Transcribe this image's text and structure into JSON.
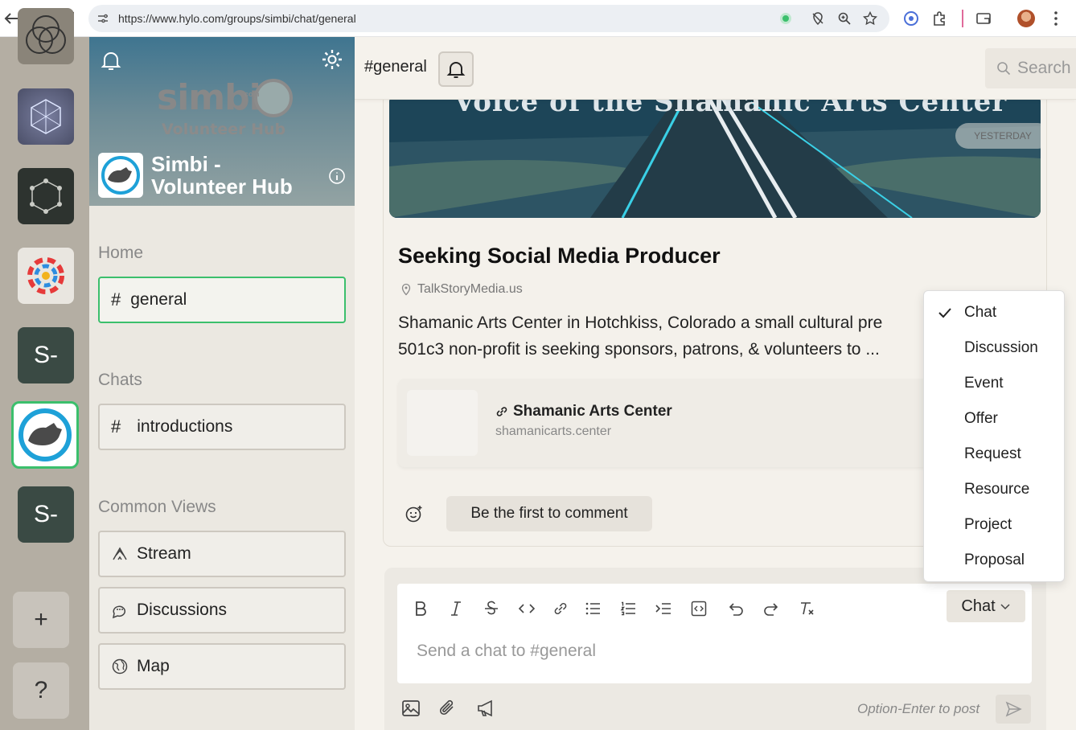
{
  "browser": {
    "url": "https://www.hylo.com/groups/simbi/chat/general"
  },
  "rail": {
    "tiles": [
      {
        "name": "group-1",
        "label": ""
      },
      {
        "name": "group-2",
        "label": ""
      },
      {
        "name": "group-3",
        "label": ""
      },
      {
        "name": "group-4",
        "label": ""
      },
      {
        "name": "group-5",
        "label": "S-"
      },
      {
        "name": "group-simbi",
        "label": ""
      },
      {
        "name": "group-7",
        "label": "S-"
      }
    ],
    "add_label": "+",
    "help_label": "?"
  },
  "sidebar": {
    "banner_logo": "simbi",
    "banner_logo_small": "com",
    "banner_subtitle": "Volunteer Hub",
    "group_name_line1": "Simbi -",
    "group_name_line2": "Volunteer Hub",
    "home_heading": "Home",
    "home_items": [
      {
        "label": "general"
      }
    ],
    "chats_heading": "Chats",
    "chat_items": [
      {
        "label": "introductions"
      }
    ],
    "views_heading": "Common Views",
    "view_items": [
      {
        "label": "Stream",
        "icon": "stream-icon"
      },
      {
        "label": "Discussions",
        "icon": "discussions-icon"
      },
      {
        "label": "Map",
        "icon": "globe-icon"
      }
    ]
  },
  "topbar": {
    "channel": "#general",
    "search_placeholder": "Search"
  },
  "post": {
    "image_caption": "Voice of the Shamanic Arts Center",
    "date_badge": "YESTERDAY",
    "title": "Seeking Social Media Producer",
    "location": "TalkStoryMedia.us",
    "body_line1": "Shamanic Arts Center in Hotchkiss, Colorado a small cultural pre",
    "body_line2": "501c3 non-profit is seeking sponsors, patrons, & volunteers to ...",
    "link_title": "Shamanic Arts Center",
    "link_url": "shamanicarts.center",
    "comment_cta": "Be the first to comment"
  },
  "composer": {
    "type_label": "Chat",
    "placeholder": "Send a chat to #general",
    "hint": "Option-Enter to post"
  },
  "dropdown": {
    "selected": "Chat",
    "options": [
      "Chat",
      "Discussion",
      "Event",
      "Offer",
      "Request",
      "Resource",
      "Project",
      "Proposal"
    ]
  }
}
